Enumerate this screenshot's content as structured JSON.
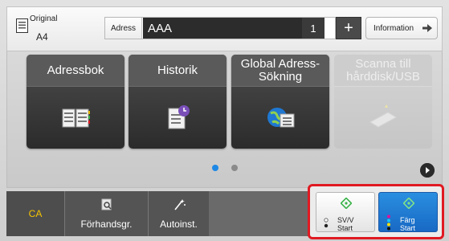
{
  "header": {
    "original_label": "Original",
    "original_value": "A4",
    "address_label": "Adress",
    "address_value": "AAA",
    "address_count": "1",
    "add_symbol": "+",
    "info_label": "Information"
  },
  "tiles": [
    {
      "label": "Adressbok",
      "icon": "address-book-icon",
      "enabled": true
    },
    {
      "label": "Historik",
      "icon": "history-icon",
      "enabled": true
    },
    {
      "label": "Global Adress-Sökning",
      "icon": "global-address-search-icon",
      "enabled": true
    },
    {
      "label": "Scanna till hårddisk/USB",
      "icon": "scan-to-drive-icon",
      "enabled": false
    }
  ],
  "pager": {
    "current_page": 1,
    "total_pages": 2
  },
  "bottom": {
    "ca_label": "CA",
    "preview_label": "Förhandsgr.",
    "auto_label": "Autoinst.",
    "bw_start_line1": "SV/V",
    "bw_start_line2": "Start",
    "color_start_line1": "Färg",
    "color_start_line2": "Start"
  },
  "colors": {
    "accent_red": "#e01a22",
    "start_green": "#3cb44b",
    "color_start_blue": "#1f78d2",
    "ca_yellow": "#f5c400",
    "pager_active": "#1e88e5"
  }
}
